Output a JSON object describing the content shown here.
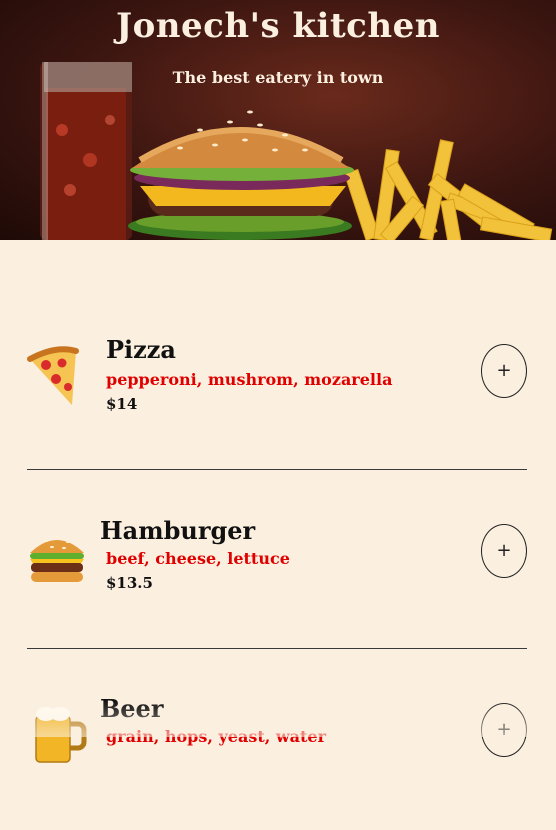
{
  "header": {
    "title": "Jonech's kitchen",
    "subtitle": "The best eatery in town"
  },
  "menu": {
    "items": [
      {
        "icon": "pizza-icon",
        "name": "Pizza",
        "ingredients": "pepperoni, mushrom, mozarella",
        "price": "$14",
        "add_label": "+"
      },
      {
        "icon": "hamburger-icon",
        "name": "Hamburger",
        "ingredients": "beef, cheese, lettuce",
        "price": "$13.5",
        "add_label": "+"
      },
      {
        "icon": "beer-mug-icon",
        "name": "Beer",
        "ingredients": "grain, hops, yeast, water",
        "price": "",
        "add_label": "+"
      }
    ]
  },
  "colors": {
    "background": "#fbefe0",
    "ingredients": "#e00000",
    "hero_dark": "#3b1510"
  }
}
